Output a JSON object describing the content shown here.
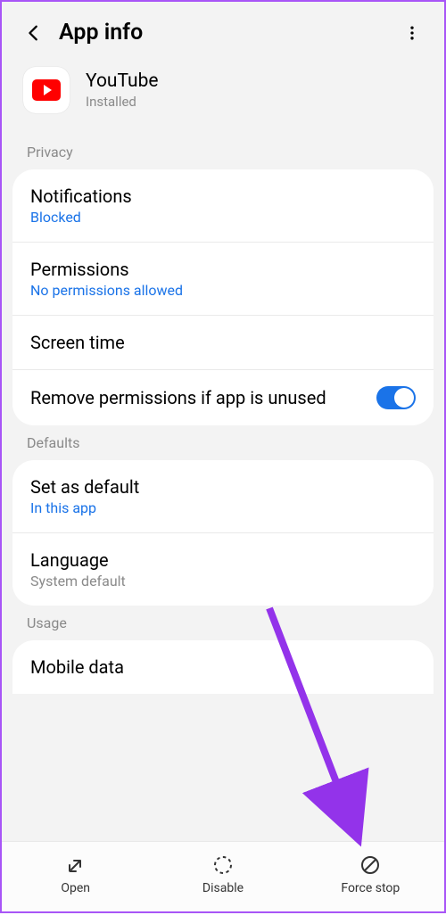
{
  "header": {
    "title": "App info"
  },
  "app": {
    "name": "YouTube",
    "status": "Installed"
  },
  "sections": {
    "privacy": {
      "label": "Privacy",
      "items": [
        {
          "title": "Notifications",
          "sub": "Blocked",
          "subClass": "blue"
        },
        {
          "title": "Permissions",
          "sub": "No permissions allowed",
          "subClass": "blue"
        },
        {
          "title": "Screen time"
        },
        {
          "title": "Remove permissions if app is unused",
          "toggle": true
        }
      ]
    },
    "defaults": {
      "label": "Defaults",
      "items": [
        {
          "title": "Set as default",
          "sub": "In this app",
          "subClass": "blue"
        },
        {
          "title": "Language",
          "sub": "System default",
          "subClass": "gray"
        }
      ]
    },
    "usage": {
      "label": "Usage",
      "items": [
        {
          "title": "Mobile data"
        }
      ]
    }
  },
  "bottom": {
    "open": "Open",
    "disable": "Disable",
    "forcestop": "Force stop"
  }
}
